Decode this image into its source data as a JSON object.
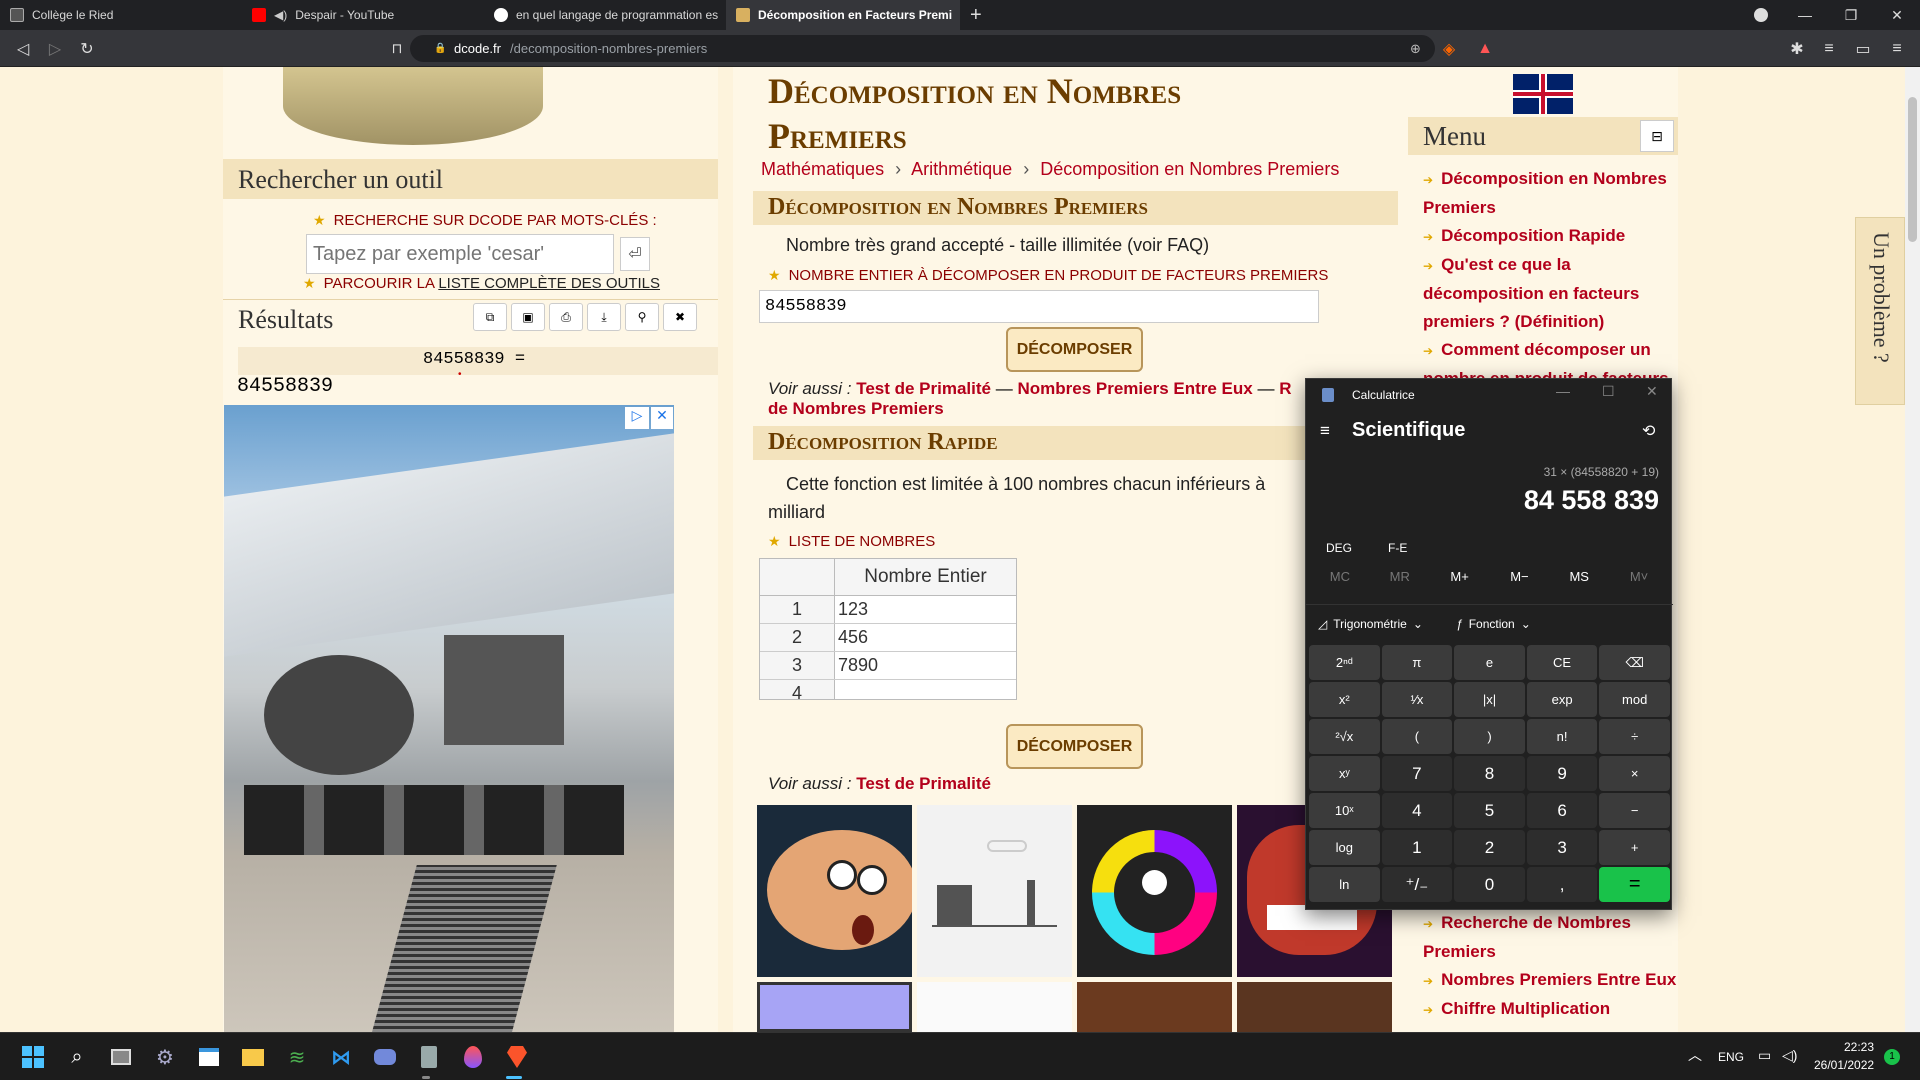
{
  "browser": {
    "tabs": [
      {
        "title": "Collège le Ried",
        "active": false
      },
      {
        "title": "Despair - YouTube",
        "active": false
      },
      {
        "title": "en quel langage de programmation es",
        "active": false
      },
      {
        "title": "Décomposition en Facteurs Premi",
        "active": true
      }
    ],
    "new_tab": "+",
    "url_domain": "dcode.fr",
    "url_path": "/decomposition-nombres-premiers"
  },
  "left": {
    "search_title": "Rechercher un outil",
    "keyword_label": "RECHERCHE SUR DCODE PAR MOTS-CLÉS :",
    "search_placeholder": "Tapez par exemple 'cesar'",
    "browse_prefix": "PARCOURIR LA ",
    "browse_link": "LISTE COMPLÈTE DES OUTILS",
    "results_title": "Résultats",
    "result_expr": "84558839 =",
    "result_value": "84558839",
    "ad_badges": [
      "▷",
      "✕"
    ]
  },
  "main": {
    "title_line1": "Décomposition en Nombres",
    "title_line2": "Premiers",
    "breadcrumb": [
      "Mathématiques",
      "Arithmétique",
      "Décomposition en Nombres Premiers"
    ],
    "section1": {
      "title": "Décomposition en Nombres Premiers",
      "note": "Nombre très grand accepté - taille illimitée (voir FAQ)",
      "field_label": "NOMBRE ENTIER À DÉCOMPOSER EN PRODUIT DE FACTEURS PREMIERS",
      "field_value": "84558839",
      "button": "DÉCOMPOSER",
      "see_also_label": "Voir aussi :",
      "see_also_1": "Test de Primalité",
      "sep": "—",
      "see_also_2": "Nombres Premiers Entre Eux",
      "see_also_3_start": "R",
      "see_also_3_end": "de Nombres Premiers"
    },
    "section2": {
      "title": "Décomposition Rapide",
      "note_line1": "Cette fonction est limitée à 100 nombres chacun inférieurs à",
      "note_line2": "milliard",
      "list_label": "LISTE DE NOMBRES",
      "table_header": "Nombre Entier",
      "rows": [
        {
          "n": "1",
          "v": "123"
        },
        {
          "n": "2",
          "v": "456"
        },
        {
          "n": "3",
          "v": "7890"
        },
        {
          "n": "4",
          "v": ""
        }
      ],
      "button": "DÉCOMPOSER",
      "see_also_label": "Voir aussi :",
      "see_also_1": "Test de Primalité"
    }
  },
  "right": {
    "menu_title": "Menu",
    "menu_toggle": "⊟",
    "items_top": [
      "Décomposition en Nombres",
      "Premiers",
      "Décomposition Rapide",
      "Qu'est ce que la",
      "décomposition en facteurs",
      "premiers ? (Définition)",
      "Comment décomposer un",
      "nombre en produit de facteurs"
    ],
    "items_bottom": [
      "Recherche de Nombres",
      "Premiers",
      "Nombres Premiers Entre Eux",
      "Chiffre Multiplication"
    ],
    "problem_tab": "Un problème ?"
  },
  "calculator": {
    "app_title": "Calculatrice",
    "mode": "Scientifique",
    "expression": "31 × (84558820 + 19)",
    "display": "84 558 839",
    "deg": "DEG",
    "fe": "F-E",
    "memory": [
      "MC",
      "MR",
      "M+",
      "M−",
      "MS",
      "M˅"
    ],
    "trig": "Trigonométrie",
    "func": "Fonction",
    "keys": [
      [
        "2ⁿᵈ",
        "π",
        "e",
        "CE",
        "⌫"
      ],
      [
        "x²",
        "¹⁄x",
        "|x|",
        "exp",
        "mod"
      ],
      [
        "²√x",
        "(",
        ")",
        "n!",
        "÷"
      ],
      [
        "xʸ",
        "7",
        "8",
        "9",
        "×"
      ],
      [
        "10ˣ",
        "4",
        "5",
        "6",
        "−"
      ],
      [
        "log",
        "1",
        "2",
        "3",
        "+"
      ],
      [
        "ln",
        "⁺/₋",
        "0",
        ",",
        "="
      ]
    ]
  },
  "taskbar": {
    "lang": "ENG",
    "time": "22:23",
    "date": "26/01/2022",
    "notif": "1"
  },
  "colors": {
    "link": "#b3001b",
    "heading": "#6b3d00",
    "accent_green": "#19c24a"
  }
}
